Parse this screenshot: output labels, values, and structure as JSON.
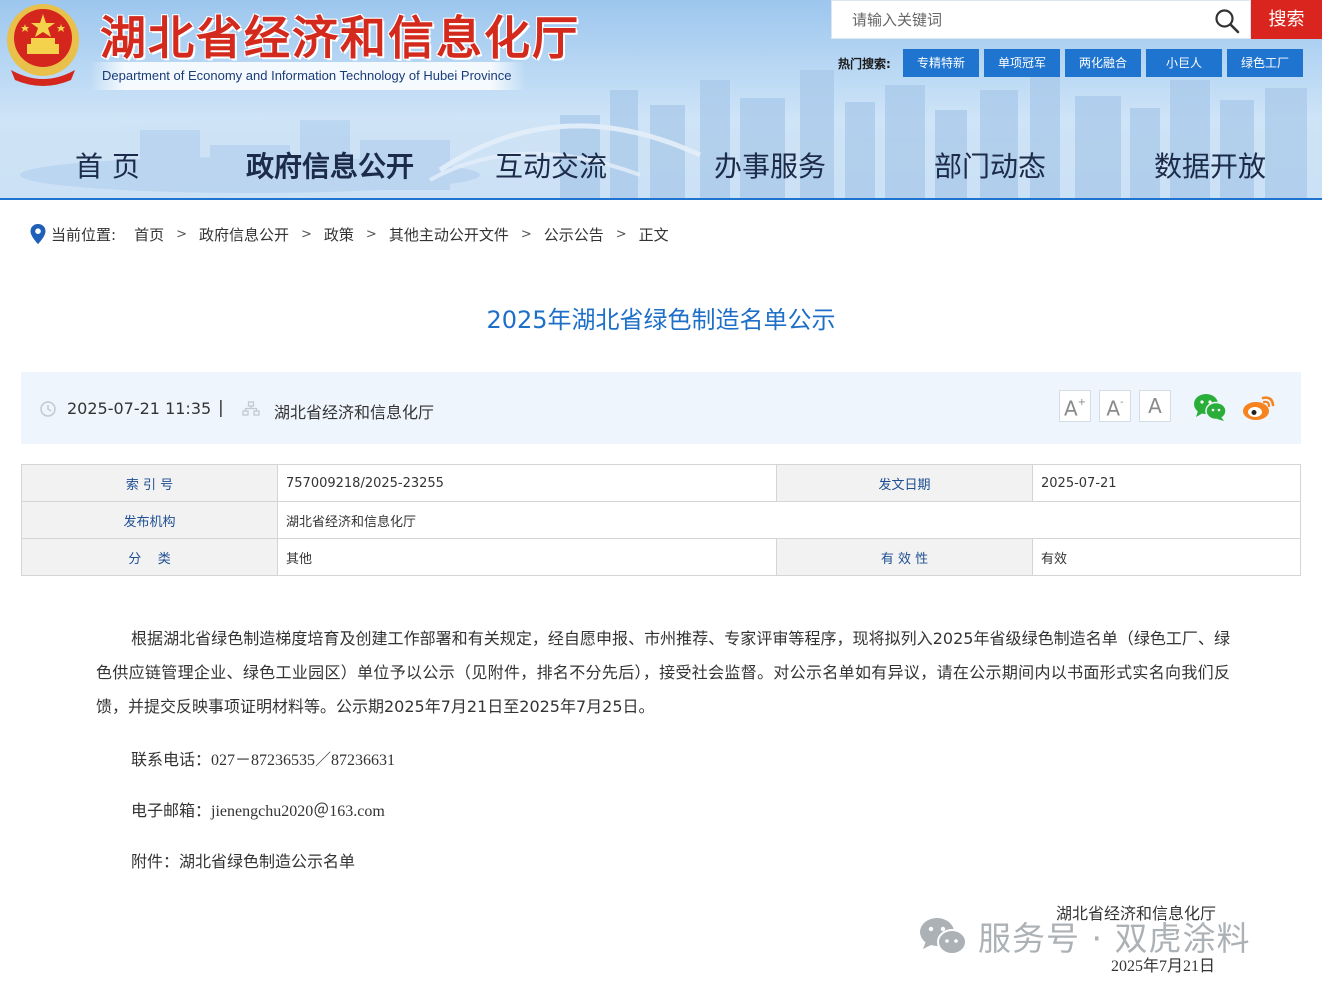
{
  "header": {
    "site_title": "湖北省经济和信息化厅",
    "site_subtitle": "Department of Economy and Information Technology of Hubei Province",
    "search": {
      "placeholder": "请输入关键词",
      "button_label": "搜索"
    },
    "hot_search": {
      "label": "热门搜索:",
      "tags": [
        "专精特新",
        "单项冠军",
        "两化融合",
        "小巨人",
        "绿色工厂"
      ]
    },
    "nav": [
      "首 页",
      "政府信息公开",
      "互动交流",
      "办事服务",
      "部门动态",
      "数据开放"
    ],
    "nav_active_index": 1,
    "colors": {
      "title_red": "#d42a1e",
      "accent_blue": "#1f74d0",
      "search_red": "#d9251d"
    }
  },
  "breadcrumb": {
    "label": "当前位置:",
    "items": [
      "首页",
      "政府信息公开",
      "政策",
      "其他主动公开文件",
      "公示公告",
      "正文"
    ],
    "separator": ">"
  },
  "article": {
    "title": "2025年湖北省绿色制造名单公示",
    "datetime": "2025-07-21 11:35",
    "divider": "|",
    "source": "湖北省经济和信息化厅",
    "font_controls": [
      "A+",
      "A-",
      "A"
    ],
    "share": [
      "wechat-icon",
      "weibo-icon"
    ]
  },
  "info_table": {
    "index_label": "索 引 号",
    "index_value": "757009218/2025-23255",
    "date_label": "发文日期",
    "date_value": "2025-07-21",
    "issuer_label": "发布机构",
    "issuer_value": "湖北省经济和信息化厅",
    "category_label": "分    类",
    "category_value": "其他",
    "validity_label": "有 效 性",
    "validity_value": "有效"
  },
  "body": {
    "paragraph": "根据湖北省绿色制造梯度培育及创建工作部署和有关规定，经自愿申报、市州推荐、专家评审等程序，现将拟列入2025年省级绿色制造名单（绿色工厂、绿色供应链管理企业、绿色工业园区）单位予以公示（见附件，排名不分先后），接受社会监督。对公示名单如有异议，请在公示期间内以书面形式实名向我们反馈，并提交反映事项证明材料等。公示期2025年7月21日至2025年7月25日。",
    "phone_label": "联系电话：",
    "phone_value": "027－87236535／87236631",
    "email_label": "电子邮箱：",
    "email_value": "jienengchu2020＠163.com",
    "attachment_label": "附件：",
    "attachment_value": "湖北省绿色制造公示名单",
    "sign_org": "湖北省经济和信息化厅",
    "sign_date": "2025年7月21日"
  },
  "watermark": {
    "text": "服务号 · 双虎涂料"
  }
}
